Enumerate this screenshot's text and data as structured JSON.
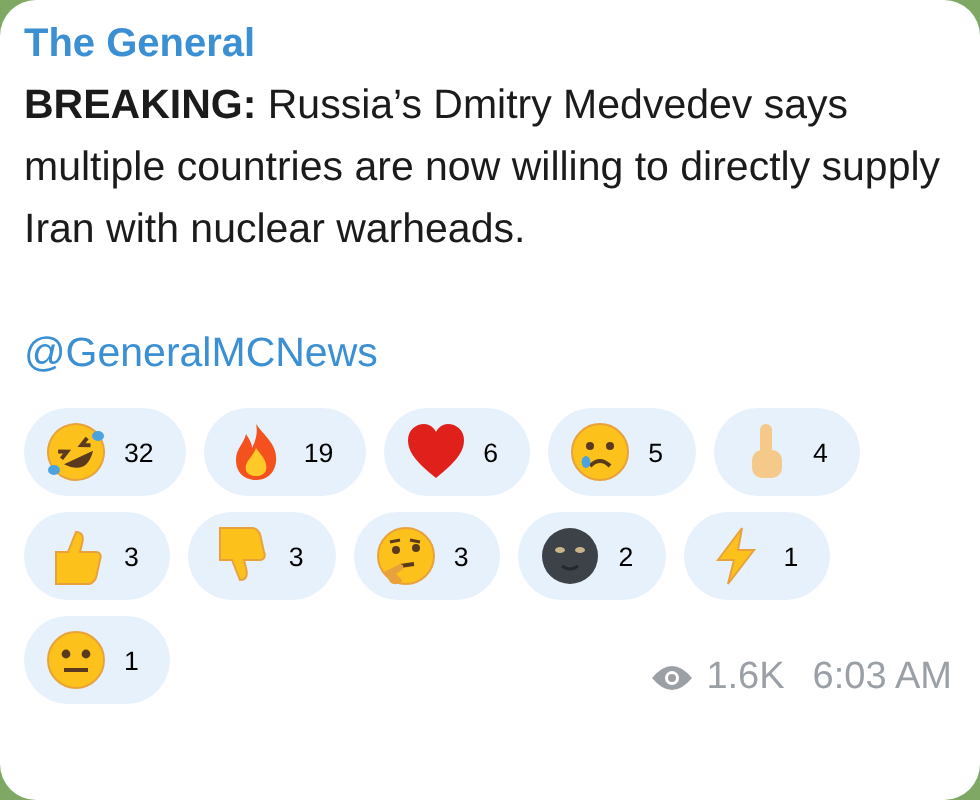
{
  "message": {
    "sender": "The General",
    "text": "**BREAKING:** Russia’s Dmitry Medvedev says multiple countries are now willing to directly supply Iran with nuclear warheads.",
    "link": "@GeneralMCNews"
  },
  "reactions": [
    {
      "kind": "rofl",
      "count": "32"
    },
    {
      "kind": "fire",
      "count": "19"
    },
    {
      "kind": "heart",
      "count": "6"
    },
    {
      "kind": "cry",
      "count": "5"
    },
    {
      "kind": "finger",
      "count": "4"
    },
    {
      "kind": "thumbs_up",
      "count": "3"
    },
    {
      "kind": "thumbs_down",
      "count": "3"
    },
    {
      "kind": "thinking",
      "count": "3"
    },
    {
      "kind": "moon",
      "count": "2"
    },
    {
      "kind": "lightning",
      "count": "1"
    },
    {
      "kind": "neutral",
      "count": "1"
    }
  ],
  "footer": {
    "views": "1.6K",
    "time": "6:03 AM"
  }
}
